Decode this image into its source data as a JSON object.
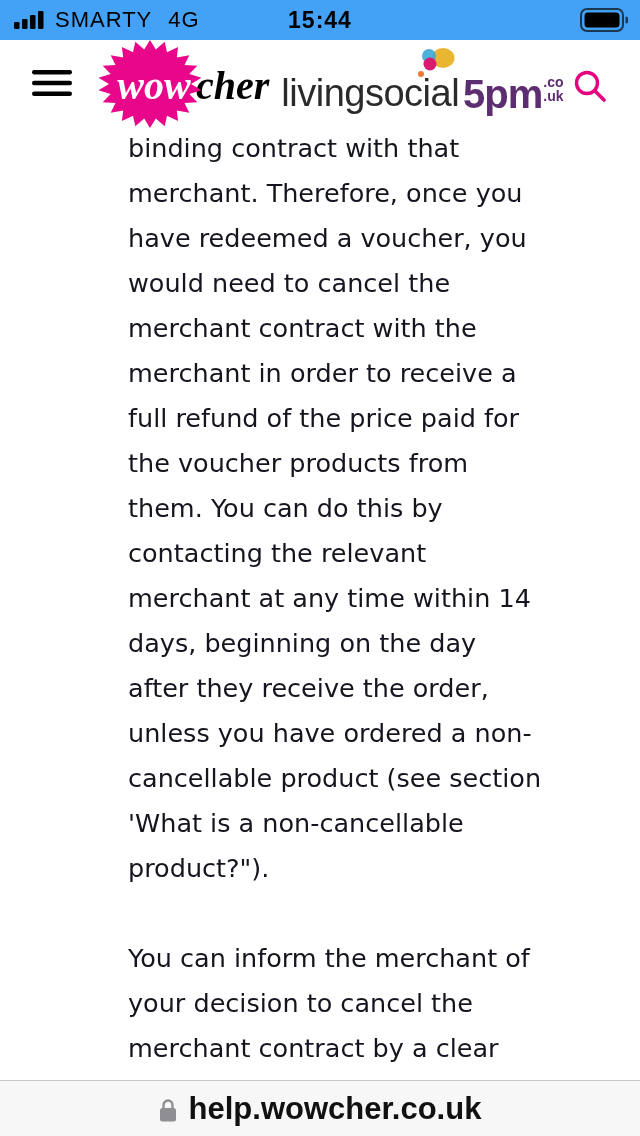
{
  "status_bar": {
    "carrier": "SMARTY",
    "network": "4G",
    "time": "15:44"
  },
  "header": {
    "wowcher_logo": {
      "burst_text": "wow",
      "text": "cher"
    },
    "livingsocial_logo": {
      "text": "livingsocial"
    },
    "fivepm_logo": {
      "text": "5pm",
      "suffix_top": ".co",
      "suffix_bottom": ".uk"
    }
  },
  "article": {
    "paragraphs": [
      {
        "lines": [
          "binding contract with that",
          "merchant. Therefore, once you",
          "have redeemed a voucher, you",
          "would need to cancel the",
          "merchant contract with the",
          "merchant in order to receive a",
          "full refund of the price paid for",
          "the voucher products from",
          "them. You can do this by",
          "contacting the relevant",
          "merchant at any time within 14",
          "days, beginning on the day",
          "after they receive the order,",
          "unless you have ordered a non-",
          "cancellable product (see section",
          "'What is a non-cancellable",
          "product?\")."
        ]
      },
      {
        "lines": [
          "You can inform the merchant of",
          "your decision to cancel the",
          "merchant contract by a clear"
        ]
      }
    ]
  },
  "address_bar": {
    "url": "help.wowcher.co.uk",
    "secure": true
  }
}
